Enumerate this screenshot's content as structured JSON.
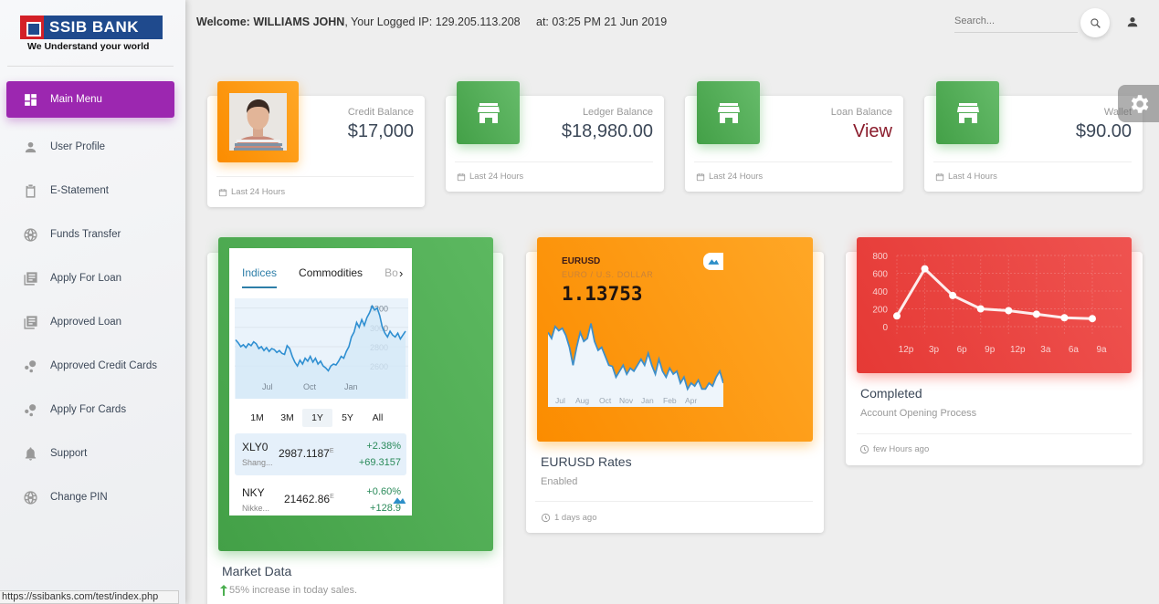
{
  "brand": {
    "name": "SSIB BANK",
    "tagline": "We Understand your world"
  },
  "sidebar": {
    "items": [
      {
        "label": "Main Menu",
        "icon": "dashboard-icon",
        "active": true
      },
      {
        "label": "User Profile",
        "icon": "person-icon"
      },
      {
        "label": "E-Statement",
        "icon": "clipboard-icon"
      },
      {
        "label": "Funds Transfer",
        "icon": "globe-icon"
      },
      {
        "label": "Apply For Loan",
        "icon": "library-books-icon"
      },
      {
        "label": "Approved Loan",
        "icon": "library-books-icon"
      },
      {
        "label": "Approved Credit Cards",
        "icon": "bubbles-icon"
      },
      {
        "label": "Apply For Cards",
        "icon": "bubbles-icon"
      },
      {
        "label": "Support",
        "icon": "bell-icon"
      },
      {
        "label": "Change PIN",
        "icon": "globe-icon"
      }
    ]
  },
  "status_url": "https://ssibanks.com/test/index.php",
  "header": {
    "welcome_label": "Welcome:",
    "user_name": "WILLIAMS JOHN",
    "ip_label": ", Your Logged IP: 129.205.113.208",
    "time_label": "at: 03:25 PM 21 Jun 2019",
    "search_placeholder": "Search..."
  },
  "stats": [
    {
      "category": "Credit Balance",
      "value": "$17,000",
      "footer": "Last 24 Hours",
      "icon": "user-photo"
    },
    {
      "category": "Ledger Balance",
      "value": "$18,980.00",
      "footer": "Last 24 Hours",
      "icon": "store-icon"
    },
    {
      "category": "Loan Balance",
      "value": "View",
      "footer": "Last 24 Hours",
      "icon": "store-icon"
    },
    {
      "category": "Wallet",
      "value": "$90.00",
      "footer": "Last 4 Hours",
      "icon": "store-icon"
    }
  ],
  "market_card": {
    "title": "Market Data",
    "subtitle": "55% increase in today sales.",
    "tabs": [
      "Indices",
      "Commodities",
      "Bo"
    ],
    "range_options": [
      "1M",
      "3M",
      "1Y",
      "5Y",
      "All"
    ],
    "selected_range": "1Y",
    "quotes": [
      {
        "symbol": "XLY0",
        "name": "Shang...",
        "price": "2987.1187",
        "suffix": "E",
        "change_pct": "+2.38%",
        "change": "+69.3157"
      },
      {
        "symbol": "NKY",
        "name": "Nikke...",
        "price": "21462.86",
        "suffix": "E",
        "change_pct": "+0.60%",
        "change": "+128.9"
      }
    ]
  },
  "eurusd_card": {
    "symbol": "EURUSD",
    "description": "EURO / U.S. DOLLAR",
    "price": "1.13753",
    "title": "EURUSD Rates",
    "subtitle": "Enabled",
    "footer": "1 days ago"
  },
  "completed_card": {
    "title": "Completed",
    "subtitle": "Account Opening Process",
    "footer": "few Hours ago"
  },
  "chart_data": [
    {
      "type": "area",
      "title": "Indices",
      "x_ticks": [
        "Jul",
        "Oct",
        "Jan"
      ],
      "y_ticks": [
        2600,
        2800,
        3000,
        3200
      ],
      "ylim": [
        2450,
        3300
      ],
      "values": [
        2870,
        2840,
        2800,
        2820,
        2790,
        2830,
        2810,
        2850,
        2830,
        2780,
        2800,
        2760,
        2790,
        2750,
        2780,
        2770,
        2740,
        2760,
        2730,
        2720,
        2810,
        2780,
        2700,
        2640,
        2600,
        2660,
        2620,
        2680,
        2650,
        2700,
        2640,
        2680,
        2620,
        2650,
        2600,
        2580,
        2550,
        2600,
        2620,
        2610,
        2650,
        2700,
        2680,
        2750,
        2800,
        2900,
        2950,
        3050,
        3000,
        3080,
        3020,
        3100,
        3150,
        3220,
        3180,
        3200,
        3120,
        3000,
        2940,
        2900,
        2960,
        2920,
        2900,
        2940,
        2880,
        2920,
        2960
      ],
      "grid": true
    },
    {
      "type": "area",
      "title": "EURUSD",
      "x_ticks": [
        "Jul",
        "Aug",
        "Oct",
        "Nov",
        "Jan",
        "Feb",
        "Apr"
      ],
      "ylim": [
        1.09,
        1.24
      ],
      "values": [
        1.215,
        1.205,
        1.225,
        1.218,
        1.222,
        1.21,
        1.19,
        1.16,
        1.19,
        1.215,
        1.2,
        1.205,
        1.23,
        1.2,
        1.185,
        1.19,
        1.175,
        1.16,
        1.158,
        1.14,
        1.15,
        1.16,
        1.145,
        1.155,
        1.15,
        1.16,
        1.17,
        1.16,
        1.18,
        1.16,
        1.145,
        1.17,
        1.15,
        1.14,
        1.155,
        1.145,
        1.15,
        1.13,
        1.14,
        1.12,
        1.13,
        1.125,
        1.135,
        1.12,
        1.12,
        1.13,
        1.125,
        1.14,
        1.15,
        1.13
      ],
      "grid": false
    },
    {
      "type": "line",
      "title": "",
      "categories": [
        "12p",
        "3p",
        "6p",
        "9p",
        "12p",
        "3a",
        "6a",
        "9a"
      ],
      "values": [
        120,
        650,
        350,
        200,
        180,
        140,
        100,
        90
      ],
      "y_ticks": [
        0,
        200,
        400,
        600,
        800
      ],
      "ylim": [
        0,
        800
      ],
      "grid": true
    }
  ],
  "colors": {
    "primary": "#9c27b0",
    "success": "#4caf50",
    "warning": "#ff9800",
    "danger": "#e53935",
    "view_link": "#8a1b2b"
  }
}
